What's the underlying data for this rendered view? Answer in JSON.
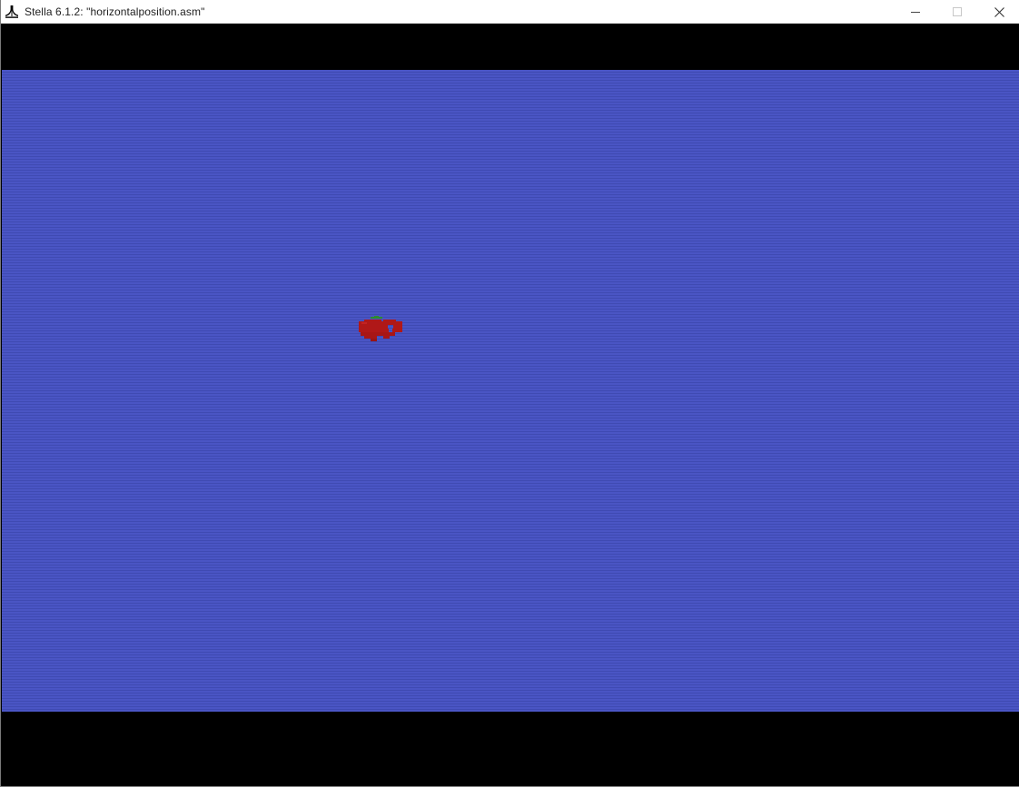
{
  "window": {
    "title": "Stella 6.1.2: \"horizontalposition.asm\"",
    "app_icon": "atari-fuji-icon",
    "controls": {
      "minimize_icon": "minimize-icon",
      "maximize_icon": "maximize-icon",
      "close_icon": "close-icon"
    }
  },
  "emulator": {
    "background_color": "#4550bd",
    "border_color": "#000000",
    "sprite": {
      "name": "red-apple",
      "body_color": "#b01818",
      "stem_color": "#2e8a2e"
    }
  }
}
